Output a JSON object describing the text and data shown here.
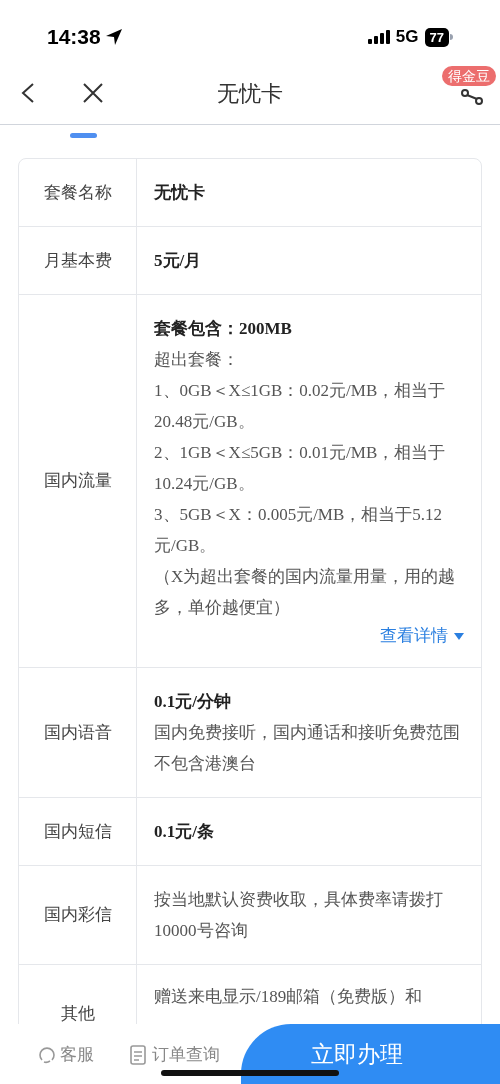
{
  "status_bar": {
    "time": "14:38",
    "network": "5G",
    "battery": "77"
  },
  "nav": {
    "title": "无忧卡",
    "badge": "得金豆"
  },
  "table": {
    "rows": [
      {
        "label": "套餐名称",
        "lines": [
          {
            "text": "无忧卡",
            "bold": true
          }
        ]
      },
      {
        "label": "月基本费",
        "lines": [
          {
            "text": "5元/月",
            "bold": true
          }
        ]
      },
      {
        "label": "国内流量",
        "lines": [
          {
            "text": "套餐包含：200MB",
            "bold": true
          },
          {
            "text": "超出套餐：",
            "bold": false
          },
          {
            "text": "1、0GB＜X≤1GB：0.02元/MB，相当于20.48元/GB。",
            "bold": false
          },
          {
            "text": "2、1GB＜X≤5GB：0.01元/MB，相当于10.24元/GB。",
            "bold": false
          },
          {
            "text": "3、5GB＜X：0.005元/MB，相当于5.12元/GB。",
            "bold": false
          },
          {
            "text": "（X为超出套餐的国内流量用量，用的越多，单价越便宜）",
            "bold": false
          }
        ],
        "link": "查看详情"
      },
      {
        "label": "国内语音",
        "lines": [
          {
            "text": "0.1元/分钟",
            "bold": true
          },
          {
            "text": "国内免费接听，国内通话和接听免费范围不包含港澳台",
            "bold": false
          }
        ]
      },
      {
        "label": "国内短信",
        "lines": [
          {
            "text": "0.1元/条",
            "bold": true
          }
        ]
      },
      {
        "label": "国内彩信",
        "lines": [
          {
            "text": "按当地默认资费收取，具体费率请拨打10000号咨询",
            "bold": false
          }
        ]
      },
      {
        "label": "其他",
        "lines": [
          {
            "text": "赠送来电显示/189邮箱（免费版）和",
            "bold": false
          }
        ]
      }
    ]
  },
  "bottom_bar": {
    "service": "客服",
    "orders": "订单查询",
    "action": "立即办理"
  }
}
